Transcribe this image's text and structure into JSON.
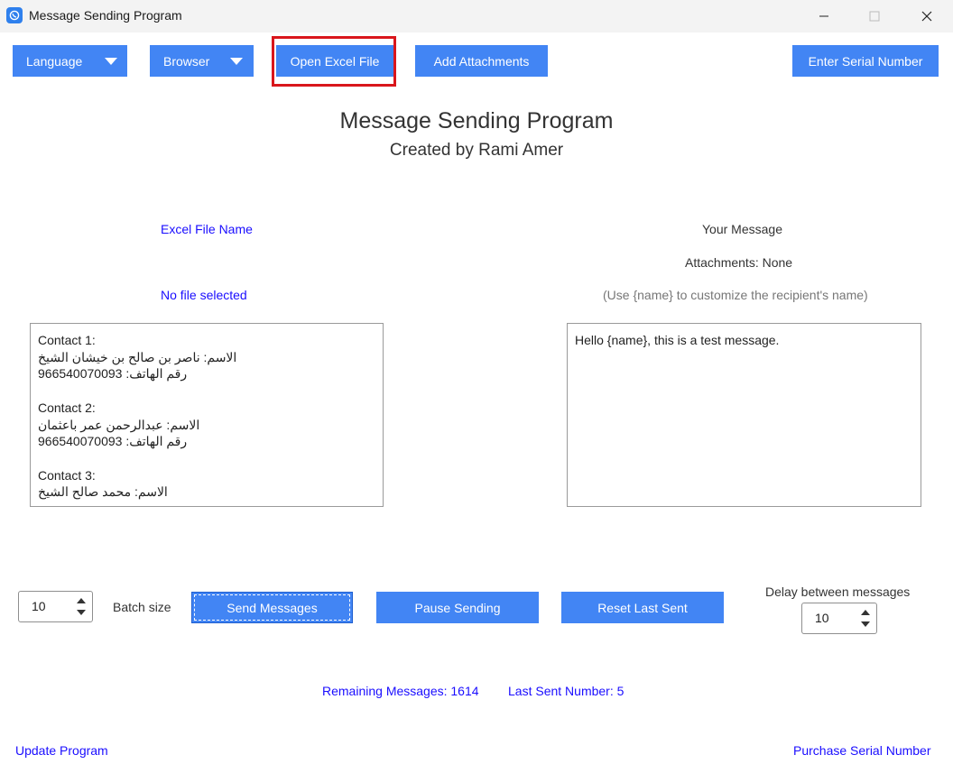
{
  "window": {
    "title": "Message Sending Program",
    "icon": "whatsapp-icon"
  },
  "toolbar": {
    "language": "Language",
    "browser": "Browser",
    "open_excel": "Open Excel File",
    "add_attachments": "Add Attachments",
    "enter_serial": "Enter Serial Number"
  },
  "header": {
    "title": "Message Sending Program",
    "subtitle": "Created by Rami Amer"
  },
  "left_panel": {
    "excel_label": "Excel File Name",
    "file_status": "No file selected",
    "contacts": [
      {
        "heading": "Contact 1:",
        "name": "الاسم: ناصر بن صالح بن خيشان الشيخ",
        "phone": "رقم الهاتف: 966540070093"
      },
      {
        "heading": "Contact 2:",
        "name": "الاسم: عبدالرحمن عمر باعثمان",
        "phone": "رقم الهاتف: 966540070093"
      },
      {
        "heading": "Contact 3:",
        "name": "الاسم: محمد صالح الشيخ",
        "phone": ""
      }
    ]
  },
  "right_panel": {
    "your_message_label": "Your Message",
    "attachments": "Attachments: None",
    "hint": "(Use {name} to customize the recipient's name)",
    "message": "Hello {name}, this is a test message."
  },
  "controls": {
    "batch_value": "10",
    "batch_label": "Batch size",
    "send": "Send Messages",
    "pause": "Pause Sending",
    "reset": "Reset Last Sent",
    "delay_label": "Delay between messages",
    "delay_value": "10"
  },
  "status": {
    "remaining": "Remaining Messages: 1614",
    "last_sent": "Last Sent Number: 5"
  },
  "footer": {
    "update": "Update Program",
    "purchase": "Purchase Serial Number"
  },
  "colors": {
    "button": "#4285f4",
    "link": "#1a0dff",
    "highlight": "#d9161c"
  }
}
